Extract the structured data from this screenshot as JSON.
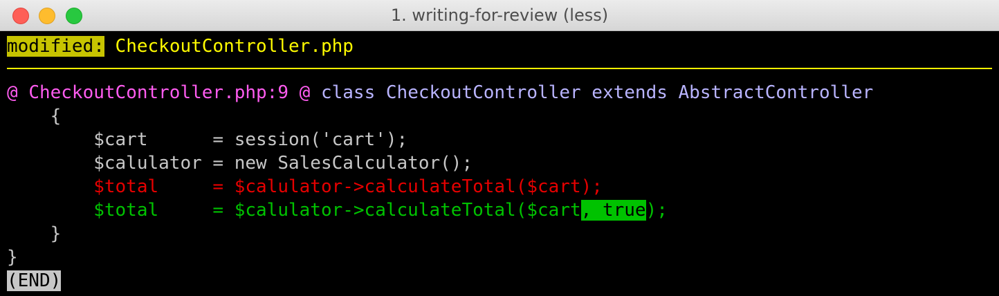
{
  "window": {
    "title": "1. writing-for-review (less)"
  },
  "diff": {
    "status_label": "modified:",
    "filename": "CheckoutController.php",
    "hunk": {
      "marker_open": "@",
      "location": "CheckoutController.php:9",
      "marker_close": "@",
      "context": "class CheckoutController extends AbstractController"
    },
    "lines": {
      "open_brace": "    {",
      "cart": "        $cart      = session('cart');",
      "calculator": "        $calulator = new SalesCalculator();",
      "removed": "        $total     = $calulator->calculateTotal($cart);",
      "added_prefix": "        $total     = $calulator->calculateTotal($cart",
      "added_highlight": ", true",
      "added_suffix": ");",
      "close_inner": "    }",
      "close_outer": "}"
    },
    "end_marker": "(END)"
  },
  "colors": {
    "status_badge": "#c7c400",
    "filename": "#fffb00",
    "hunk_location": "#ff5cf0",
    "hunk_context": "#b9b4ff",
    "removed": "#e60000",
    "added": "#00c200"
  }
}
